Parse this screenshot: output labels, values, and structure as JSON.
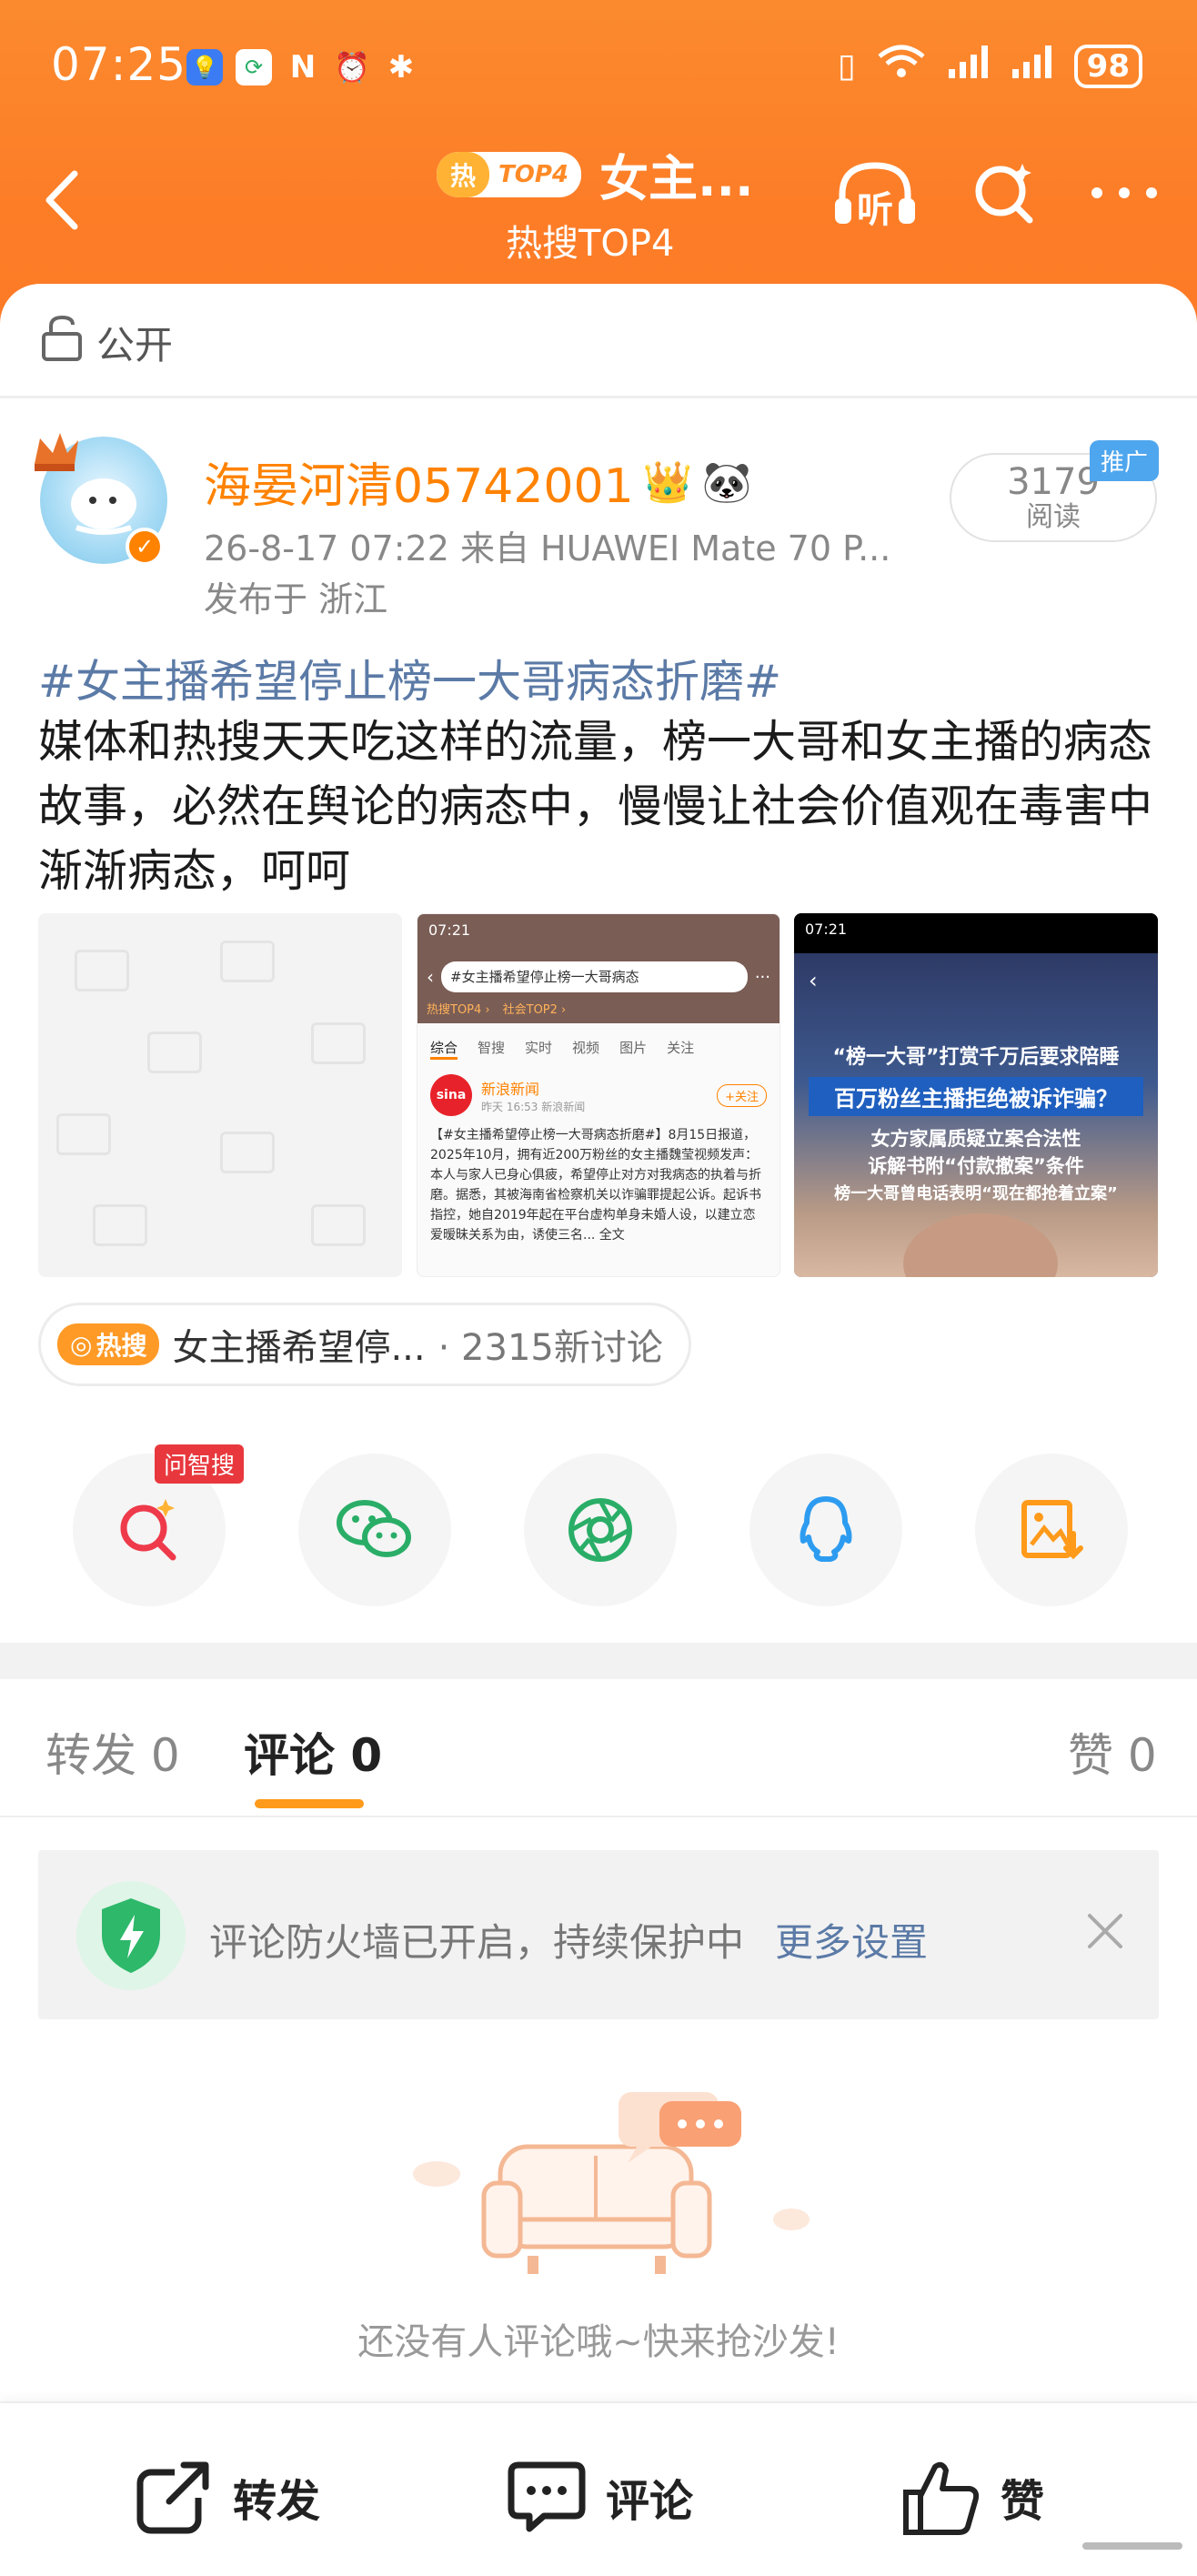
{
  "status_bar": {
    "time": "07:25",
    "battery": "98"
  },
  "nav": {
    "hot_label": "热",
    "top_label": "TOP4",
    "title": "女主...",
    "subtitle": "热搜TOP4",
    "listen_label": "听"
  },
  "visibility": {
    "label": "公开"
  },
  "post": {
    "username": "海晏河清05742001",
    "meta_line": "26-8-17 07:22  来自 HUAWEI Mate 70 P...",
    "location": "发布于 浙江",
    "reads": "3179",
    "reads_label": "阅读",
    "promo_badge": "推广",
    "hashtag": "#女主播希望停止榜一大哥病态折磨#",
    "body": "媒体和热搜天天吃这样的流量，榜一大哥和女主播的病态故事，必然在舆论的病态中，慢慢让社会价值观在毒害中渐渐病态，呵呵",
    "images": {
      "img2": {
        "time": "07:21",
        "search_text": "#女主播希望停止榜一大哥病态",
        "chips": [
          "热搜TOP4 ›",
          "社会TOP2 ›"
        ],
        "tabs": [
          "综合",
          "智搜",
          "实时",
          "视频",
          "图片",
          "关注"
        ],
        "source_name": "新浪新闻",
        "source_meta": "昨天 16:53  新浪新闻",
        "follow_label": "+关注",
        "snippet": "【#女主播希望停止榜一大哥病态折磨#】8月15日报道，2025年10月，拥有近200万粉丝的女主播魏莹视频发声：本人与家人已身心俱疲，希望停止对方对我病态的执着与折磨。据悉，其被海南省检察机关以诈骗罪提起公诉。起诉书指控，她自2019年起在平台虚构单身未婚人设，以建立恋爱暧昧关系为由，诱使三名... 全文"
      },
      "img3": {
        "time": "07:21",
        "line1": "“榜一大哥”打赏千万后要求陪睡",
        "line2": "百万粉丝主播拒绝被诉诈骗？",
        "line3": "女方家属质疑立案合法性",
        "line4": "诉解书附“付款撤案”条件",
        "line5": "榜一大哥曾电话表明“现在都抢着立案”"
      }
    },
    "topic": {
      "hot_label": "热搜",
      "title": "女主播希望停...",
      "count": "· 2315新讨论"
    }
  },
  "share": {
    "ask_badge": "问智搜"
  },
  "tabs": [
    {
      "label": "转发 0"
    },
    {
      "label": "评论 0"
    },
    {
      "label": "赞 0"
    }
  ],
  "firewall": {
    "text": "评论防火墙已开启，持续保护中",
    "link": "更多设置"
  },
  "empty_text": "还没有人评论哦~快来抢沙发!",
  "bottom_bar": {
    "repost": "转发",
    "comment": "评论",
    "like": "赞"
  },
  "colors": {
    "brand_orange": "#ff8200",
    "link_blue": "#5b7aa6",
    "tab_indicator": "#ff9a1a"
  }
}
